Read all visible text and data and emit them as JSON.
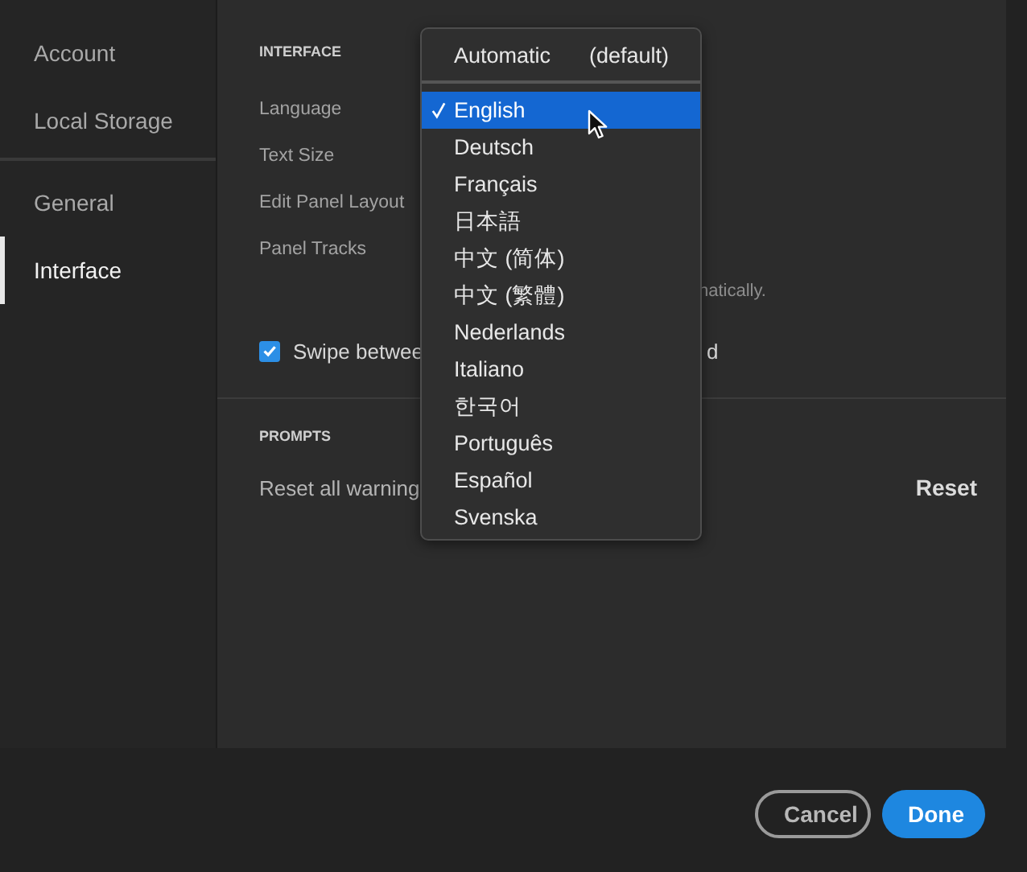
{
  "sidebar": {
    "groups": [
      {
        "items": [
          {
            "label": "Account",
            "selected": false
          },
          {
            "label": "Local Storage",
            "selected": false
          }
        ]
      },
      {
        "items": [
          {
            "label": "General",
            "selected": false
          },
          {
            "label": "Interface",
            "selected": true
          }
        ]
      }
    ]
  },
  "sections": [
    {
      "title": "INTERFACE",
      "rows": [
        {
          "label": "Language"
        },
        {
          "label": "Text Size"
        },
        {
          "label": "Edit Panel Layout"
        },
        {
          "label": "Panel Tracks"
        }
      ],
      "hint": "natically.",
      "checkbox": {
        "label": "Swipe betwee",
        "label_tail": "d",
        "checked": true
      }
    },
    {
      "title": "PROMPTS",
      "action": {
        "label": "Reset all warning",
        "button": "Reset"
      }
    }
  ],
  "language_menu": {
    "default_option": {
      "label": "Automatic",
      "note": "(default)"
    },
    "options": [
      {
        "label": "English",
        "selected": true
      },
      {
        "label": "Deutsch",
        "selected": false
      },
      {
        "label": "Français",
        "selected": false
      },
      {
        "label": "日本語",
        "selected": false
      },
      {
        "label": "中文 (简体)",
        "selected": false
      },
      {
        "label": "中文 (繁體)",
        "selected": false
      },
      {
        "label": "Nederlands",
        "selected": false
      },
      {
        "label": "Italiano",
        "selected": false
      },
      {
        "label": "한국어",
        "selected": false
      },
      {
        "label": "Português",
        "selected": false
      },
      {
        "label": "Español",
        "selected": false
      },
      {
        "label": "Svenska",
        "selected": false
      }
    ]
  },
  "footer": {
    "buttons": [
      {
        "label": "Cancel",
        "kind": "secondary"
      },
      {
        "label": "Done",
        "kind": "primary"
      }
    ]
  }
}
